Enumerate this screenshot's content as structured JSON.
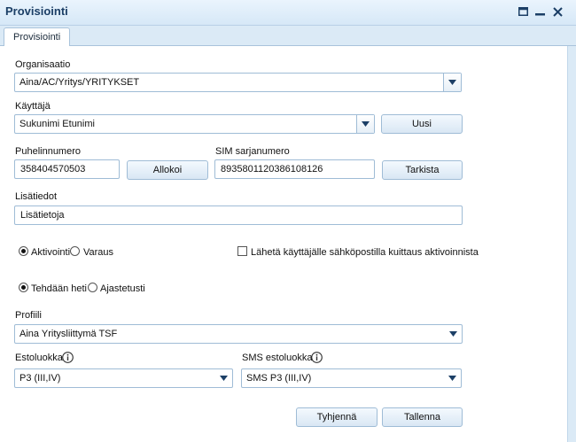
{
  "window": {
    "title": "Provisiointi"
  },
  "tabs": [
    {
      "label": "Provisiointi"
    }
  ],
  "form": {
    "organisaatio": {
      "label": "Organisaatio",
      "value": "Aina/AC/Yritys/YRITYKSET"
    },
    "kayttaja": {
      "label": "Käyttäjä",
      "value": "Sukunimi Etunimi",
      "new_button": "Uusi"
    },
    "puhelinnumero": {
      "label": "Puhelinnumero",
      "value": "358404570503",
      "allocate_button": "Allokoi"
    },
    "sim": {
      "label": "SIM sarjanumero",
      "value": "8935801120386108126",
      "check_button": "Tarkista"
    },
    "lisatiedot": {
      "label": "Lisätiedot",
      "value": "Lisätietoja"
    },
    "mode": {
      "option_activate": "Aktivointi",
      "option_reserve": "Varaus",
      "selected": "Aktivointi"
    },
    "send_email": {
      "label": "Lähetä käyttäjälle sähköpostilla kuittaus aktivoinnista",
      "checked": false
    },
    "timing": {
      "option_now": "Tehdään heti",
      "option_scheduled": "Ajastetusti",
      "selected": "Tehdään heti"
    },
    "profiili": {
      "label": "Profiili",
      "value": "Aina Yritysliittymä TSF"
    },
    "estoluokka": {
      "label": "Estoluokka",
      "value": "P3 (III,IV)"
    },
    "sms_estoluokka": {
      "label": "SMS estoluokka",
      "value": "SMS P3 (III,IV)"
    },
    "buttons": {
      "clear": "Tyhjennä",
      "save": "Tallenna"
    }
  },
  "icons": {
    "maximize": "maximize-icon",
    "minimize": "minimize-icon",
    "close": "close-icon",
    "dropdown": "triangle-down-icon",
    "info": "info-icon"
  },
  "colors": {
    "title_text": "#1c3f66",
    "border": "#9fbcd6",
    "tab_strip": "#dbeaf6"
  }
}
